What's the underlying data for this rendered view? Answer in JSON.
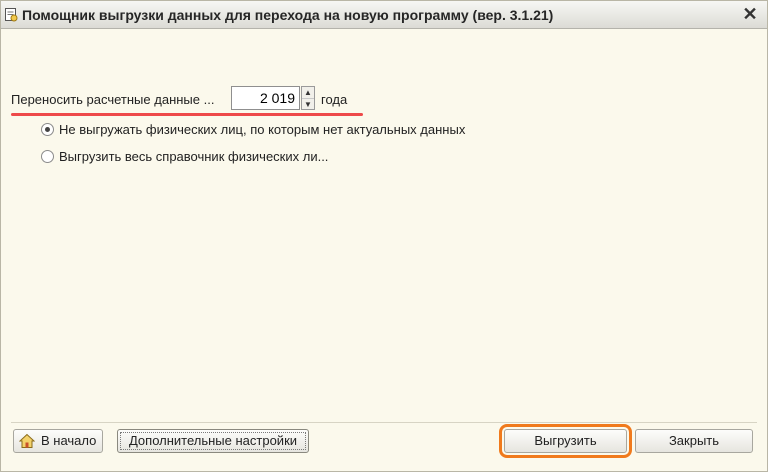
{
  "window": {
    "title": "Помощник выгрузки данных для перехода на новую программу (вер. 3.1.21)",
    "close_glyph": "✕"
  },
  "period": {
    "label": "Переносить расчетные данные ...",
    "year_value": "2 019",
    "suffix": "года",
    "spin_up": "▲",
    "spin_down": "▼"
  },
  "options": [
    {
      "label": "Не выгружать физических лиц, по которым нет актуальных данных",
      "selected": true
    },
    {
      "label": "Выгрузить весь справочник физических ли...",
      "selected": false
    }
  ],
  "footer": {
    "home_label": "В начало",
    "settings_label": "Дополнительные настройки",
    "export_label": "Выгрузить",
    "close_label": "Закрыть"
  },
  "annotations": {
    "underline_color": "#ee4a4a",
    "export_highlight_color": "#f07a1c"
  },
  "icons": {
    "title": "document-gear-icon",
    "home": "home-icon",
    "close": "close-icon"
  }
}
